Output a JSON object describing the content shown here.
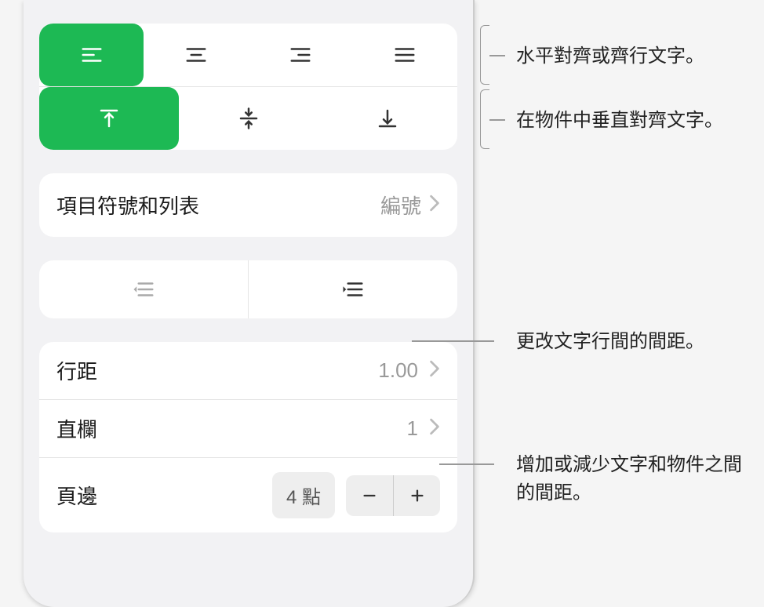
{
  "alignment": {
    "horizontal_selected": "left",
    "vertical_selected": "top"
  },
  "bullets": {
    "label": "項目符號和列表",
    "value": "編號"
  },
  "line_spacing": {
    "label": "行距",
    "value": "1.00"
  },
  "columns": {
    "label": "直欄",
    "value": "1"
  },
  "margin": {
    "label": "頁邊",
    "value": "4 點"
  },
  "callouts": {
    "horizontal_align": "水平對齊或齊行文字。",
    "vertical_align": "在物件中垂直對齊文字。",
    "line_spacing": "更改文字行間的間距。",
    "margin": "增加或減少文字和物件之間的間距。"
  }
}
